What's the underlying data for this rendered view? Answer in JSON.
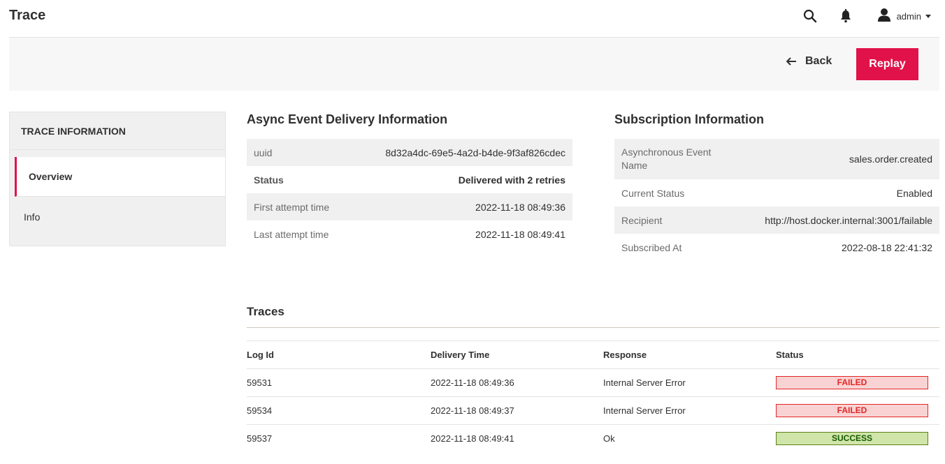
{
  "header": {
    "title": "Trace",
    "search_icon": "search-icon",
    "notifications_icon": "bell-icon",
    "user_icon": "user-icon",
    "user_name": "admin"
  },
  "actionbar": {
    "back_label": "Back",
    "replay_label": "Replay",
    "accent_color": "#e11249"
  },
  "sidebar": {
    "title": "TRACE INFORMATION",
    "items": [
      {
        "label": "Overview",
        "active": true
      },
      {
        "label": "Info",
        "active": false
      }
    ]
  },
  "delivery": {
    "title": "Async Event Delivery Information",
    "rows": [
      {
        "label": "uuid",
        "value": "8d32a4dc-69e5-4a2d-b4de-9f3af826cdec"
      },
      {
        "label": "Status",
        "value": "Delivered with 2 retries"
      },
      {
        "label": "First attempt time",
        "value": "2022-11-18 08:49:36"
      },
      {
        "label": "Last attempt time",
        "value": "2022-11-18 08:49:41"
      }
    ]
  },
  "subscription": {
    "title": "Subscription Information",
    "rows": [
      {
        "label": "Asynchronous Event Name",
        "value": "sales.order.created"
      },
      {
        "label": "Current Status",
        "value": "Enabled"
      },
      {
        "label": "Recipient",
        "value": "http://host.docker.internal:3001/failable"
      },
      {
        "label": "Subscribed At",
        "value": "2022-08-18 22:41:32"
      }
    ]
  },
  "traces": {
    "title": "Traces",
    "columns": [
      "Log Id",
      "Delivery Time",
      "Response",
      "Status"
    ],
    "rows": [
      {
        "log_id": "59531",
        "delivery_time": "2022-11-18 08:49:36",
        "response": "Internal Server Error",
        "status": "FAILED"
      },
      {
        "log_id": "59534",
        "delivery_time": "2022-11-18 08:49:37",
        "response": "Internal Server Error",
        "status": "FAILED"
      },
      {
        "log_id": "59537",
        "delivery_time": "2022-11-18 08:49:41",
        "response": "Ok",
        "status": "SUCCESS"
      }
    ],
    "status_colors": {
      "FAILED": "#e22626",
      "SUCCESS": "#185b00"
    }
  }
}
